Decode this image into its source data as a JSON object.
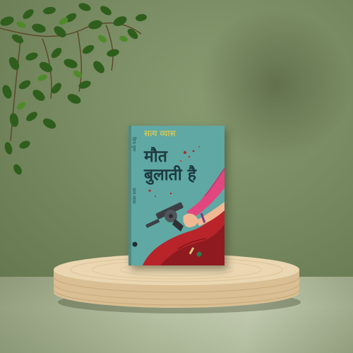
{
  "scene": {
    "description_colors": {
      "wall": "#7a8c63",
      "floor": "#b8c2a4",
      "podium_wood": "#e6cfa6",
      "book_cover": "#5fa8a3",
      "title_text": "#1d3a40",
      "author_text": "#f1d34a",
      "dress_red": "#b8242a",
      "glove_pink": "#e2467e"
    }
  },
  "book": {
    "author": "सत्य व्यास",
    "title_line1": "मौत",
    "title_line2": "बुलाती है",
    "side_label": "हिन्द युग्म",
    "side_label2": "सत्य व्यास"
  }
}
